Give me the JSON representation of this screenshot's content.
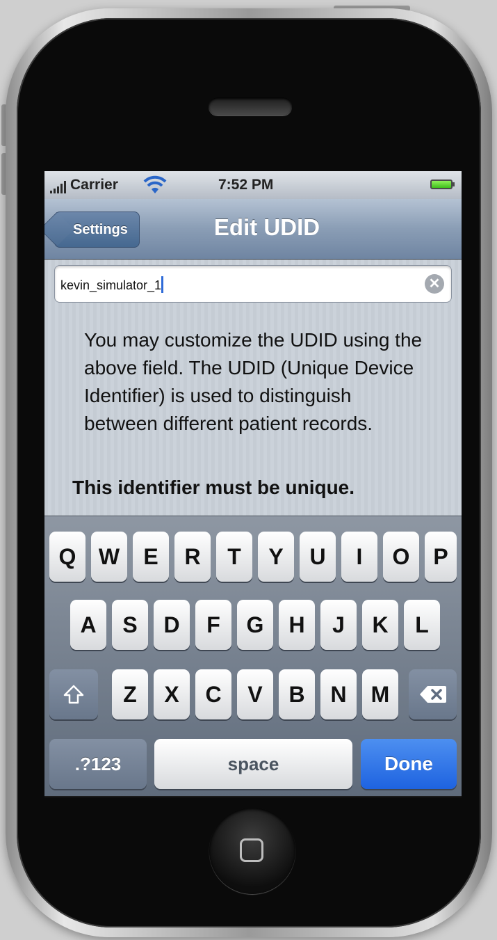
{
  "status_bar": {
    "carrier": "Carrier",
    "time": "7:52 PM"
  },
  "nav": {
    "back_label": "Settings",
    "title": "Edit UDID"
  },
  "udid_field": {
    "value": "kevin_simulator_1"
  },
  "description": "You may customize the UDID using the above field. The UDID (Unique Device Identifier) is used to distinguish between different patient records.",
  "warning": "This identifier must be unique.",
  "keyboard": {
    "row1": [
      "Q",
      "W",
      "E",
      "R",
      "T",
      "Y",
      "U",
      "I",
      "O",
      "P"
    ],
    "row2": [
      "A",
      "S",
      "D",
      "F",
      "G",
      "H",
      "J",
      "K",
      "L"
    ],
    "row3": [
      "Z",
      "X",
      "C",
      "V",
      "B",
      "N",
      "M"
    ],
    "mode_label": ".?123",
    "space_label": "space",
    "done_label": "Done"
  },
  "colors": {
    "nav_bar": "#8a9db5",
    "done_key": "#2a6ee6",
    "background_stripes": "#c5ccd4"
  }
}
